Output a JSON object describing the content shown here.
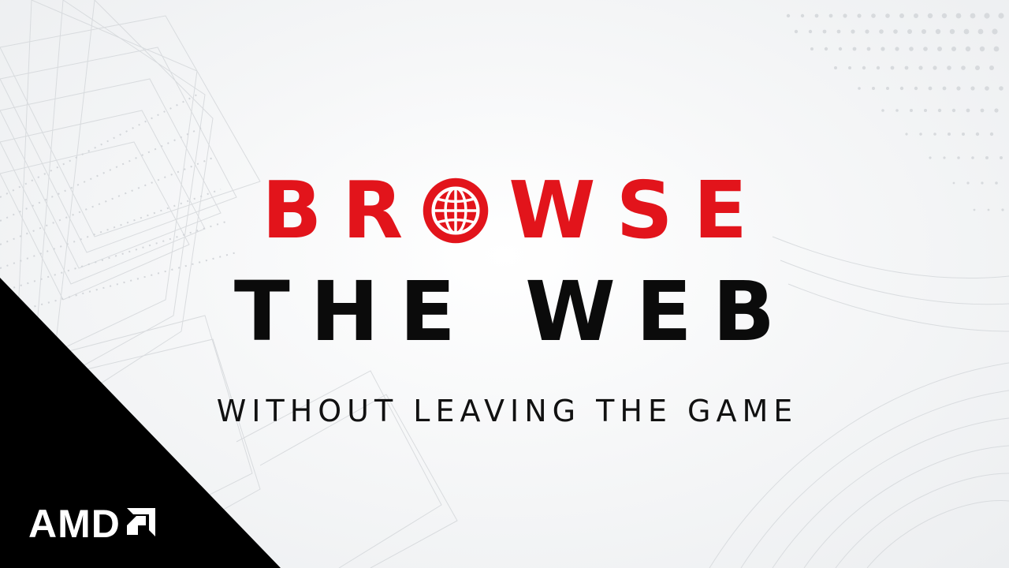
{
  "headline": {
    "browse_left": "BR",
    "browse_right": "WSE",
    "line2": "THE WEB",
    "subtitle": "WITHOUT LEAVING THE GAME"
  },
  "logo": {
    "text": "AMD"
  },
  "icons": {
    "globe": "globe-icon",
    "logo_mark": "amd-arrow-icon"
  },
  "colors": {
    "accent_red": "#e2141b",
    "text_black": "#0b0b0b",
    "corner_black": "#000000",
    "background": "#f4f5f6"
  }
}
